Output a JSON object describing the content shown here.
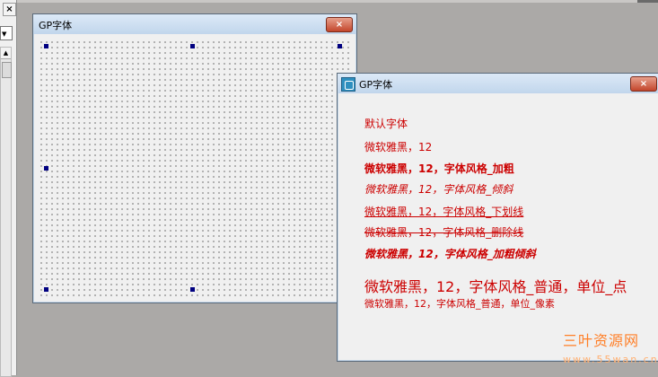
{
  "left_panel": {
    "close_glyph": "×",
    "combo_arrow": "▼",
    "scroll_up": "▲"
  },
  "designer_window": {
    "title": "GP字体",
    "close_glyph": "×"
  },
  "runtime_window": {
    "title": "GP字体",
    "close_glyph": "×",
    "lines": [
      {
        "text": "默认字体"
      },
      {
        "text": "微软雅黑，12"
      },
      {
        "text": "微软雅黑，12，字体风格_加粗"
      },
      {
        "text": "微软雅黑，12，字体风格_倾斜"
      },
      {
        "text": "微软雅黑，12，字体风格_下划线"
      },
      {
        "text": "微软雅黑，12，字体风格_删除线"
      },
      {
        "text": "微软雅黑，12，字体风格_加粗倾斜"
      },
      {
        "text": "微软雅黑，12，字体风格_普通，单位_点"
      },
      {
        "text": "微软雅黑，12，字体风格_普通，单位_像素"
      }
    ]
  },
  "watermark": {
    "cn": "三叶资源网",
    "en": "www.55wan.cn"
  },
  "colors": {
    "text_red": "#cc0000",
    "watermark": "#ff7f27"
  }
}
